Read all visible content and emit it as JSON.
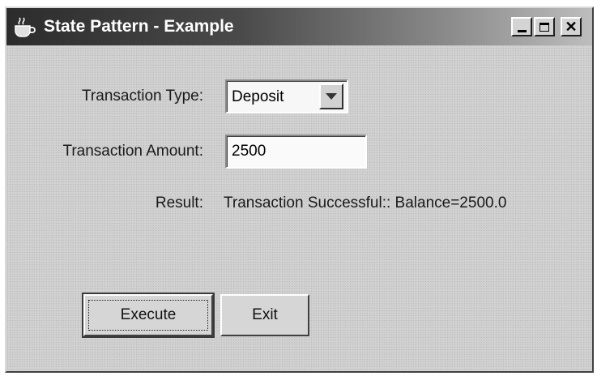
{
  "window": {
    "title": "State Pattern - Example",
    "icon": "java-coffee-cup-icon",
    "controls": {
      "minimize": "minimize-icon",
      "maximize": "maximize-icon",
      "close": "close-icon"
    }
  },
  "form": {
    "type_label": "Transaction Type:",
    "type_value": "Deposit",
    "amount_label": "Transaction Amount:",
    "amount_value": "2500",
    "result_label": "Result:",
    "result_value": "Transaction Successful:: Balance=2500.0"
  },
  "buttons": {
    "execute": "Execute",
    "exit": "Exit"
  }
}
